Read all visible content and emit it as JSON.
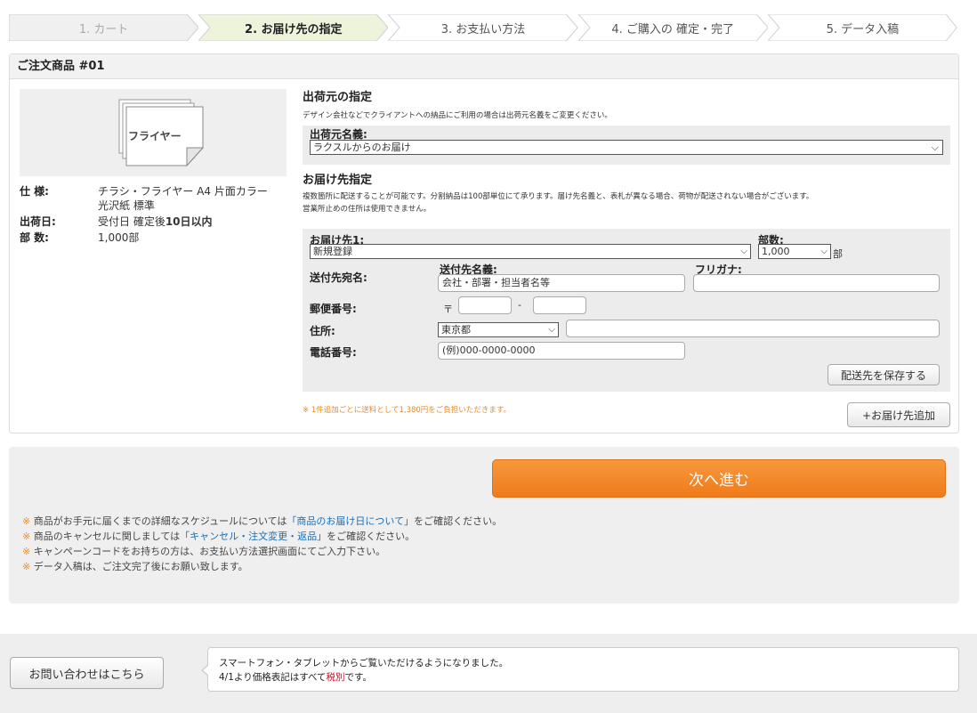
{
  "steps": [
    {
      "label": "1. カート",
      "state": "done"
    },
    {
      "label": "2. お届け先の指定",
      "state": "active"
    },
    {
      "label": "3. お支払い方法",
      "state": "todo"
    },
    {
      "label": "4. ご購入の 確定・完了",
      "state": "todo"
    },
    {
      "label": "5. データ入稿",
      "state": "todo"
    }
  ],
  "order": {
    "title": "ご注文商品 #01",
    "thumbnail_label": "フライヤー",
    "spec_label": "仕 様:",
    "spec_value": "チラシ・フライヤー A4 片面カラー 光沢紙 標準",
    "ship_label": "出荷日:",
    "ship_prefix": "受付日 確定後",
    "ship_bold": "10日以内",
    "qty_label": "部 数:",
    "qty_value": "1,000部"
  },
  "sender": {
    "heading": "出荷元の指定",
    "desc": "デザイン会社などでクライアントへの納品にご利用の場合は出荷元名義をご変更ください。",
    "name_label": "出荷元名義:",
    "name_value": "ラクスルからのお届け"
  },
  "dest": {
    "heading": "お届け先指定",
    "desc1": "複数箇所に配送することが可能です。分割納品は100部単位にて承ります。届け先名義と、表札が異なる場合、荷物が配送されない場合がございます。",
    "desc2": "営業所止めの住所は使用できません。",
    "dest_label": "お届け先1:",
    "dest_value": "新規登録",
    "copies_label": "部数:",
    "copies_value": "1,000",
    "copies_unit": "部",
    "recipient_label": "送付先宛名:",
    "recipient_name_label": "送付先名義:",
    "recipient_placeholder": "会社・部署・担当者名等",
    "furigana_label": "フリガナ:",
    "postal_label": "郵便番号:",
    "postal_mark": "〒",
    "postal_dash": "-",
    "address_label": "住所:",
    "prefecture": "東京都",
    "phone_label": "電話番号:",
    "phone_placeholder": "(例)000-0000-0000",
    "save_button": "配送先を保存する",
    "fee_note": "※ 1件追加ごとに送料として1,380円をご負担いただきます。",
    "add_button": "+お届け先追加"
  },
  "next": {
    "button": "次へ進む",
    "note1_pre": "商品がお手元に届くまでの詳細なスケジュールについては",
    "note1_link": "「商品のお届け日について」",
    "note1_post": "をご確認ください。",
    "note2_pre": "商品のキャンセルに関しましては",
    "note2_link": "「キャンセル・注文変更・返品」",
    "note2_post": "をご確認ください。",
    "note3": "キャンペーンコードをお持ちの方は、お支払い方法選択画面にてご入力下さい。",
    "note4": "データ入稿は、ご注文完了後にお願い致します。",
    "note_mark": "※"
  },
  "footer": {
    "contact_button": "お問い合わせはこちら",
    "info_line1": "スマートフォン・タブレットからご覧いただけるようになりました。",
    "info_line2_pre": "4/1より価格表記はすべて",
    "info_line2_red": "税別",
    "info_line2_post": "です。"
  },
  "colors": {
    "accent_orange": "#ef7a1a",
    "active_step": "#eef3dc",
    "link_blue": "#1b6fb5",
    "note_red": "#c8102e"
  }
}
